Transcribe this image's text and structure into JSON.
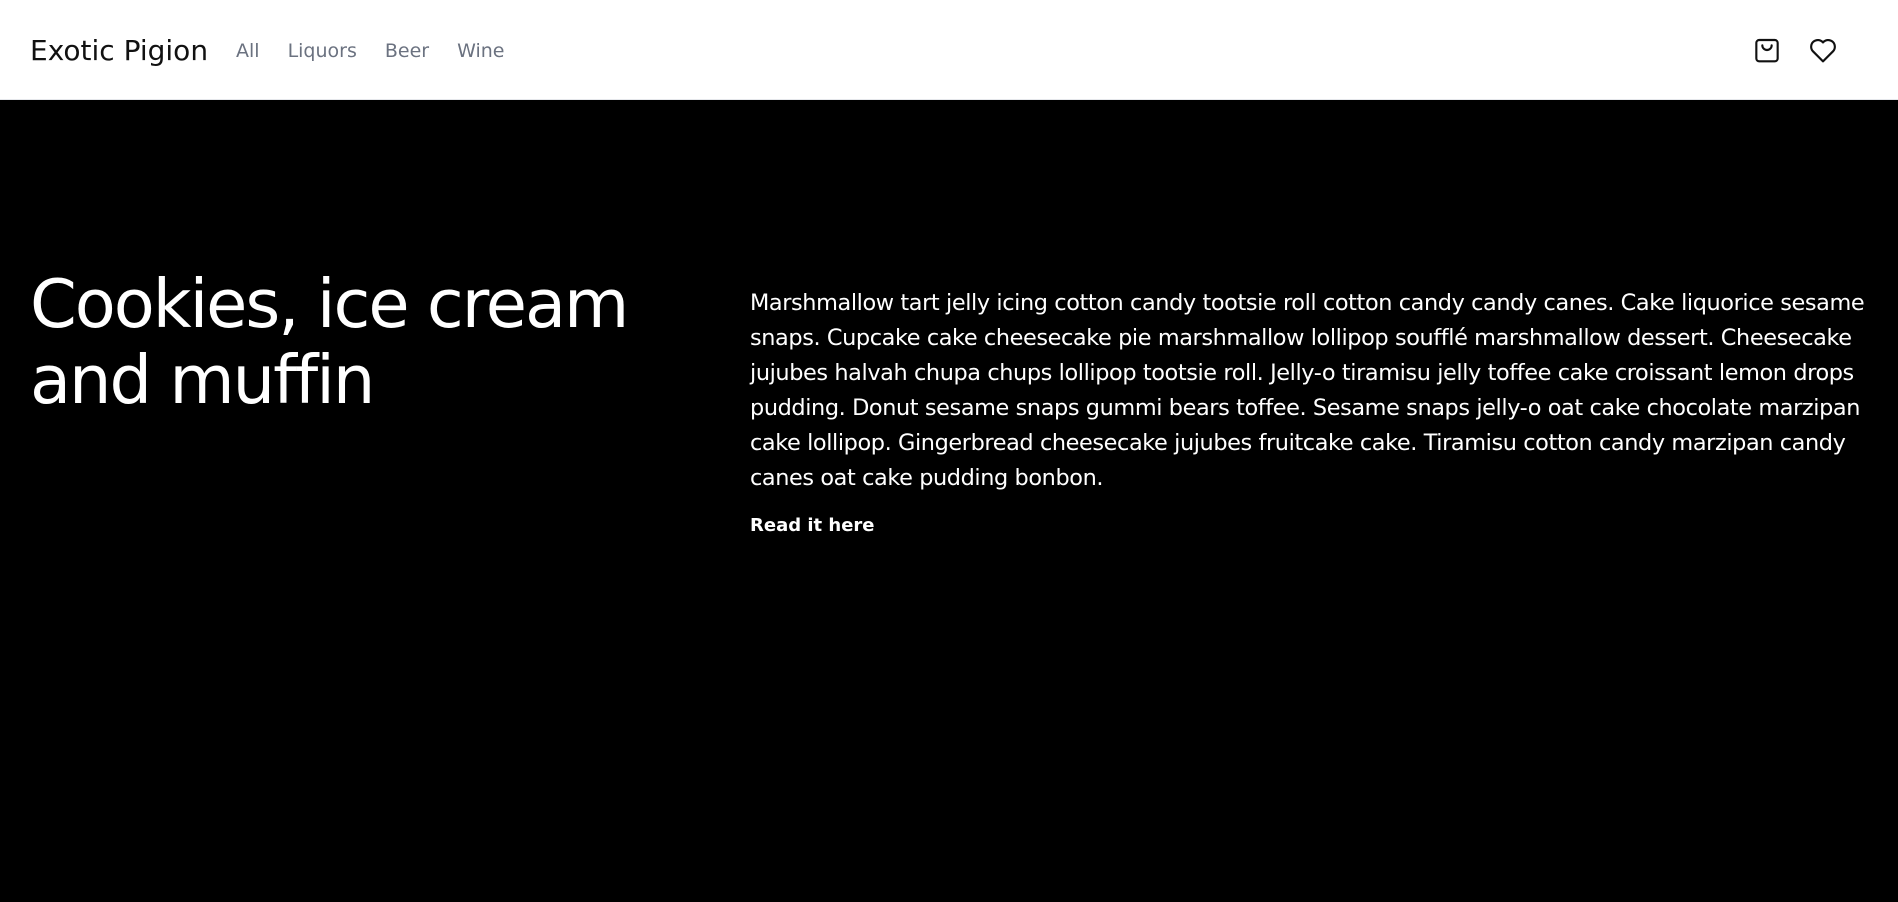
{
  "header": {
    "brand": "Exotic Pigion",
    "nav": [
      {
        "label": "All"
      },
      {
        "label": "Liquors"
      },
      {
        "label": "Beer"
      },
      {
        "label": "Wine"
      }
    ],
    "icons": {
      "cart": "shopping-bag-icon",
      "wishlist": "heart-icon"
    }
  },
  "hero": {
    "title": "Cookies, ice cream and muffin",
    "body": "Marshmallow tart jelly icing cotton candy tootsie roll cotton candy candy canes. Cake liquorice sesame snaps. Cupcake cake cheesecake pie marshmallow lollipop soufflé marshmallow dessert. Cheesecake jujubes halvah chupa chups lollipop tootsie roll. Jelly-o tiramisu jelly toffee cake croissant lemon drops pudding. Donut sesame snaps gummi bears toffee. Sesame snaps jelly-o oat cake chocolate marzipan cake lollipop. Gingerbread cheesecake jujubes fruitcake cake. Tiramisu cotton candy marzipan candy canes oat cake pudding bonbon.",
    "link_label": "Read it here"
  },
  "colors": {
    "hero_background": "#000000",
    "nav_text": "#6b7280",
    "brand_text": "#111111"
  }
}
